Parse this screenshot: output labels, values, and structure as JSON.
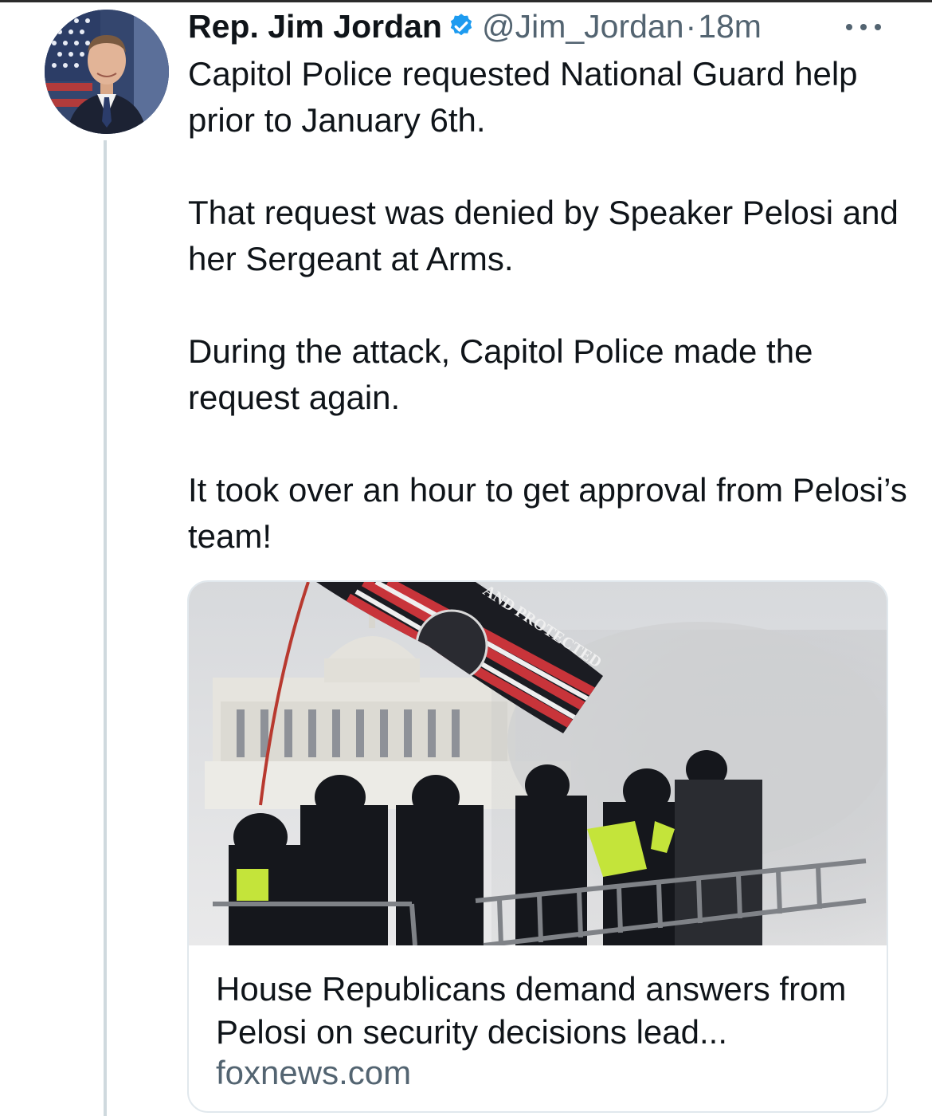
{
  "tweet": {
    "author_name": "Rep. Jim Jordan",
    "handle": "@Jim_Jordan",
    "separator": "·",
    "time": "18m",
    "paragraphs": [
      "Capitol Police requested National Guard help prior to January 6th.",
      "That request was denied by Speaker Pelosi and her Sergeant at Arms.",
      "During the attack, Capitol Police made the request again.",
      "It took over an hour to get approval from Pelosi’s team!"
    ]
  },
  "link_card": {
    "title": "House Republicans demand answers from Pelosi on security decisions lead...",
    "domain": "foxnews.com",
    "image_text": "AND PROTECTED"
  },
  "icons": {
    "avatar": "avatar-portrait-with-flag",
    "verified": "verified-badge-icon",
    "more": "more-options-icon"
  },
  "colors": {
    "verified": "#1d9bf0",
    "secondary_text": "#536471",
    "thread_line": "#cfd9de"
  }
}
